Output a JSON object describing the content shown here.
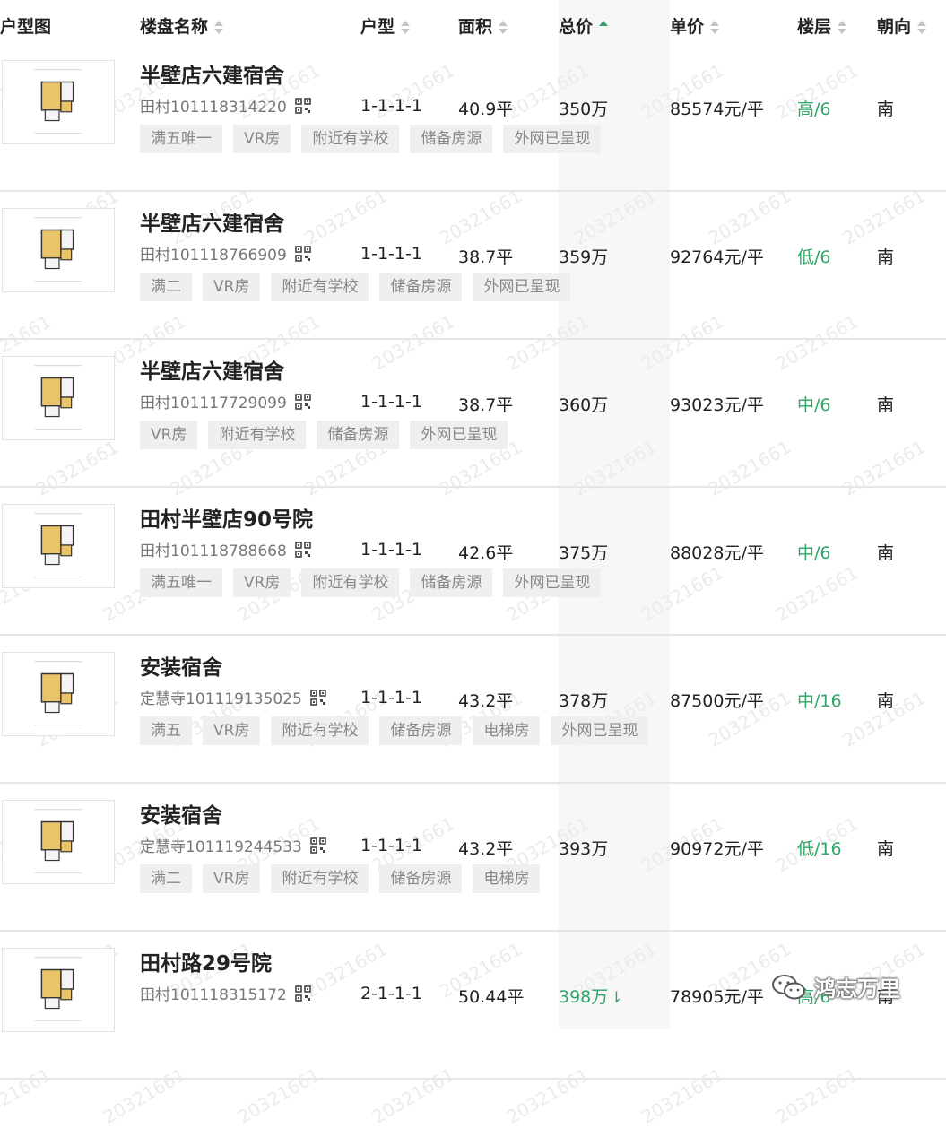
{
  "columns": [
    {
      "label": "户型图",
      "sortable": false
    },
    {
      "label": "楼盘名称",
      "sortable": true
    },
    {
      "label": "户型",
      "sortable": true
    },
    {
      "label": "面积",
      "sortable": true
    },
    {
      "label": "总价",
      "sortable": true,
      "active": true
    },
    {
      "label": "单价",
      "sortable": true
    },
    {
      "label": "楼层",
      "sortable": true
    },
    {
      "label": "朝向",
      "sortable": true
    }
  ],
  "rows": [
    {
      "name": "半壁店六建宿舍",
      "code": "田村101118314220",
      "layout": "1-1-1-1",
      "area": "40.9平",
      "total": "350万",
      "unit_price": "85574元/平",
      "floor": "高/6",
      "orientation": "南",
      "tags": [
        "满五唯一",
        "VR房",
        "附近有学校",
        "储备房源",
        "外网已呈现"
      ]
    },
    {
      "name": "半壁店六建宿舍",
      "code": "田村101118766909",
      "layout": "1-1-1-1",
      "area": "38.7平",
      "total": "359万",
      "unit_price": "92764元/平",
      "floor": "低/6",
      "orientation": "南",
      "tags": [
        "满二",
        "VR房",
        "附近有学校",
        "储备房源",
        "外网已呈现"
      ]
    },
    {
      "name": "半壁店六建宿舍",
      "code": "田村101117729099",
      "layout": "1-1-1-1",
      "area": "38.7平",
      "total": "360万",
      "unit_price": "93023元/平",
      "floor": "中/6",
      "orientation": "南",
      "tags": [
        "VR房",
        "附近有学校",
        "储备房源",
        "外网已呈现"
      ]
    },
    {
      "name": "田村半壁店90号院",
      "code": "田村101118788668",
      "layout": "1-1-1-1",
      "area": "42.6平",
      "total": "375万",
      "unit_price": "88028元/平",
      "floor": "中/6",
      "orientation": "南",
      "tags": [
        "满五唯一",
        "VR房",
        "附近有学校",
        "储备房源",
        "外网已呈现"
      ]
    },
    {
      "name": "安装宿舍",
      "code": "定慧寺101119135025",
      "layout": "1-1-1-1",
      "area": "43.2平",
      "total": "378万",
      "unit_price": "87500元/平",
      "floor": "中/16",
      "orientation": "南",
      "tags": [
        "满五",
        "VR房",
        "附近有学校",
        "储备房源",
        "电梯房",
        "外网已呈现"
      ]
    },
    {
      "name": "安装宿舍",
      "code": "定慧寺101119244533",
      "layout": "1-1-1-1",
      "area": "43.2平",
      "total": "393万",
      "unit_price": "90972元/平",
      "floor": "低/16",
      "orientation": "南",
      "tags": [
        "满二",
        "VR房",
        "附近有学校",
        "储备房源",
        "电梯房"
      ]
    },
    {
      "name": "田村路29号院",
      "code": "田村101118315172",
      "layout": "2-1-1-1",
      "area": "50.44平",
      "total": "398万",
      "total_price_down": true,
      "unit_price": "78905元/平",
      "floor": "高/6",
      "orientation": "南",
      "tags": []
    }
  ],
  "watermark": "20321661",
  "brand": {
    "text": "鸿志万里",
    "icon": "wechat-icon"
  },
  "colors": {
    "accent": "#2fa567",
    "tag_bg": "#efefef",
    "tag_text": "#888888"
  }
}
